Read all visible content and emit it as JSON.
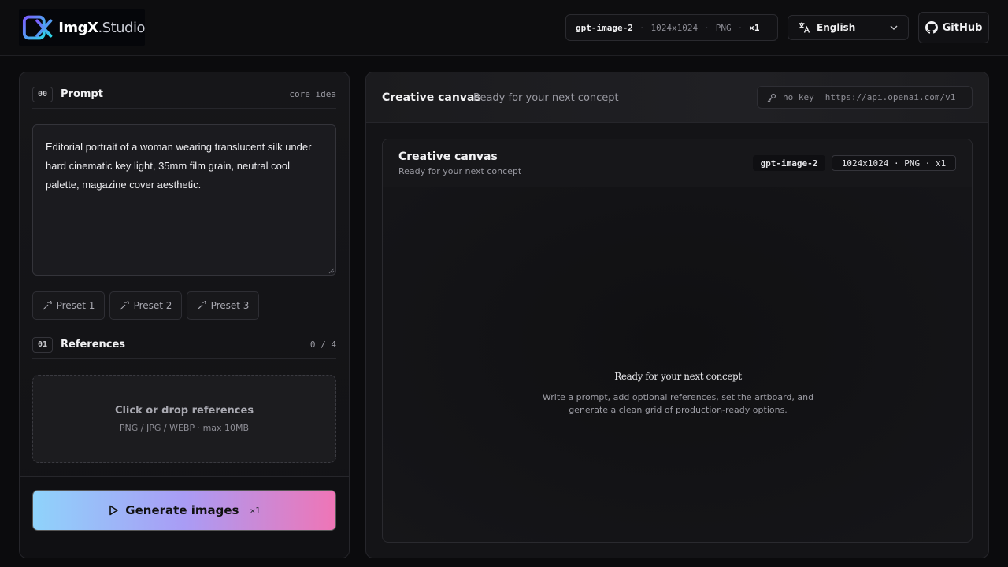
{
  "header": {
    "logo": {
      "brand": "ImgX",
      "suffix": ".Studio"
    },
    "model_pill": {
      "model": "gpt-image-2",
      "size": "1024x1024",
      "format": "PNG",
      "count": "×1"
    },
    "language": {
      "selected": "English"
    },
    "github_label": "GitHub"
  },
  "left": {
    "prompt_section": {
      "num": "00",
      "title": "Prompt",
      "right": "core idea"
    },
    "prompt_text": "Editorial portrait of a woman wearing translucent silk under hard cinematic key light, 35mm film grain, neutral cool palette, magazine cover aesthetic.",
    "presets": [
      "Preset 1",
      "Preset 2",
      "Preset 3"
    ],
    "references_section": {
      "num": "01",
      "title": "References",
      "right": "0 / 4"
    },
    "dropzone": {
      "title": "Click or drop references",
      "sub": "PNG / JPG / WEBP · max 10MB"
    },
    "generate": {
      "label": "Generate images",
      "count": "×1"
    }
  },
  "right": {
    "title": "Creative canvas",
    "subtitle": "Ready for your next concept",
    "api": {
      "key_status": "no key",
      "url": "https://api.openai.com/v1"
    },
    "canvas": {
      "title": "Creative canvas",
      "subtitle": "Ready for your next concept",
      "model_badge": "gpt-image-2",
      "spec_badge": "1024x1024 · PNG · x1",
      "empty_title": "Ready for your next concept",
      "empty_desc": "Write a prompt, add optional references, set the artboard, and generate a clean grid of production-ready options."
    }
  },
  "colors": {
    "gradient_start": "#8fd3fb",
    "gradient_mid": "#a99cf5",
    "gradient_end": "#ef75b6"
  }
}
